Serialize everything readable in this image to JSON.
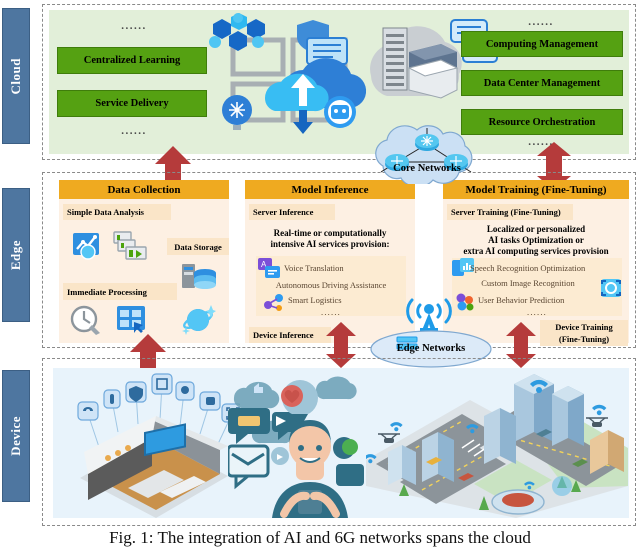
{
  "layers": [
    {
      "id": "cloud",
      "label": "Cloud"
    },
    {
      "id": "edge",
      "label": "Edge"
    },
    {
      "id": "device",
      "label": "Device"
    }
  ],
  "cloud": {
    "dots_top_left": "......",
    "dots_bottom_left": "......",
    "dots_top_right": "......",
    "dots_bottom_right": "......",
    "left_boxes": [
      {
        "label": "Centralized Learning"
      },
      {
        "label": "Service Delivery"
      }
    ],
    "right_boxes": [
      {
        "label": "Computing Management"
      },
      {
        "label": "Data Center Management"
      },
      {
        "label": "Resource Orchestration"
      }
    ],
    "icons": [
      {
        "name": "cloud-network-icon"
      },
      {
        "name": "server-rack-icon"
      },
      {
        "name": "chat-bubble-icon"
      },
      {
        "name": "shield-icon"
      },
      {
        "name": "ai-brain-bulb-icon"
      },
      {
        "name": "bot-icon"
      }
    ]
  },
  "edge": {
    "columns": [
      {
        "id": "data-collection",
        "title": "Data Collection",
        "tags": [
          {
            "label": "Simple Data Analysis"
          },
          {
            "label": "Data Storage"
          },
          {
            "label": "Immediate Processing"
          }
        ],
        "icons": [
          {
            "name": "line-chart-icon"
          },
          {
            "name": "data-flow-icon"
          },
          {
            "name": "database-server-icon"
          },
          {
            "name": "clock-wrench-icon"
          },
          {
            "name": "dashboard-grid-icon"
          },
          {
            "name": "globe-network-icon"
          }
        ]
      },
      {
        "id": "model-inference",
        "title": "Model Inference",
        "server_tag": "Server Inference",
        "device_tag": "Device Inference",
        "headline": "Real-time or computationally\nintensive AI services provision:",
        "services": [
          "Voice Translation",
          "Autonomous Driving Assistance",
          "Smart Logistics"
        ],
        "services_dots": "......",
        "icons": [
          {
            "name": "voice-translation-icon"
          },
          {
            "name": "smart-logistics-icon"
          }
        ]
      },
      {
        "id": "model-training",
        "title": "Model Training (Fine-Tuning)",
        "server_tag": "Server Training (Fine-Tuning)",
        "device_tag_line1": "Device Training",
        "device_tag_line2": "(Fine-Tuning)",
        "headline": "Localized or personalized\nAI tasks Optimization or\nextra AI computing services provision",
        "services": [
          "Speech Recognition Optimization",
          "Custom Image Recognition",
          "User Behavior Prediction"
        ],
        "services_dots": "......",
        "icons": [
          {
            "name": "speech-analytics-icon"
          },
          {
            "name": "image-recognition-icon"
          },
          {
            "name": "user-behavior-icon"
          }
        ]
      }
    ]
  },
  "networks": {
    "core": {
      "label": "Core Networks",
      "icon": "router-mesh-icon"
    },
    "edge": {
      "label": "Edge Networks",
      "icon": "cell-tower-icon"
    }
  },
  "device": {
    "scenes": [
      {
        "name": "smart-home-isometric-icon"
      },
      {
        "name": "social-user-smartphone-icon"
      },
      {
        "name": "smart-city-isometric-icon"
      }
    ],
    "iot_badges": [
      {
        "name": "camera-dome-icon"
      },
      {
        "name": "thermometer-icon"
      },
      {
        "name": "shield-lock-icon"
      },
      {
        "name": "smart-display-icon"
      },
      {
        "name": "light-bulb-icon"
      },
      {
        "name": "photo-icon"
      },
      {
        "name": "face-id-icon"
      }
    ]
  },
  "arrows": {
    "cloud_to_edge_left": "up-arrow",
    "cloud_to_edge_right": "double-arrow-vertical",
    "edge_to_device_left": "up-arrow",
    "edge_to_device_mid": "double-arrow-vertical",
    "edge_to_device_right": "double-arrow-vertical",
    "color": "#B53B3B"
  },
  "caption": {
    "text": "Fig. 1: The integration of AI and 6G networks spans the cloud"
  },
  "colors": {
    "cloud_panel": "#E2EFD9",
    "edge_panel": "#FDF0E3",
    "device_panel": "#E8F3FB",
    "green_box": "#55A112",
    "orange_header": "#EFAA20",
    "tag_bg": "#FAE5C8",
    "layer_tab": "#4E76A0",
    "arrow_red": "#B53B3B",
    "net_cloud": "#CBE0F4",
    "accent_blue": "#1E9BE8"
  }
}
